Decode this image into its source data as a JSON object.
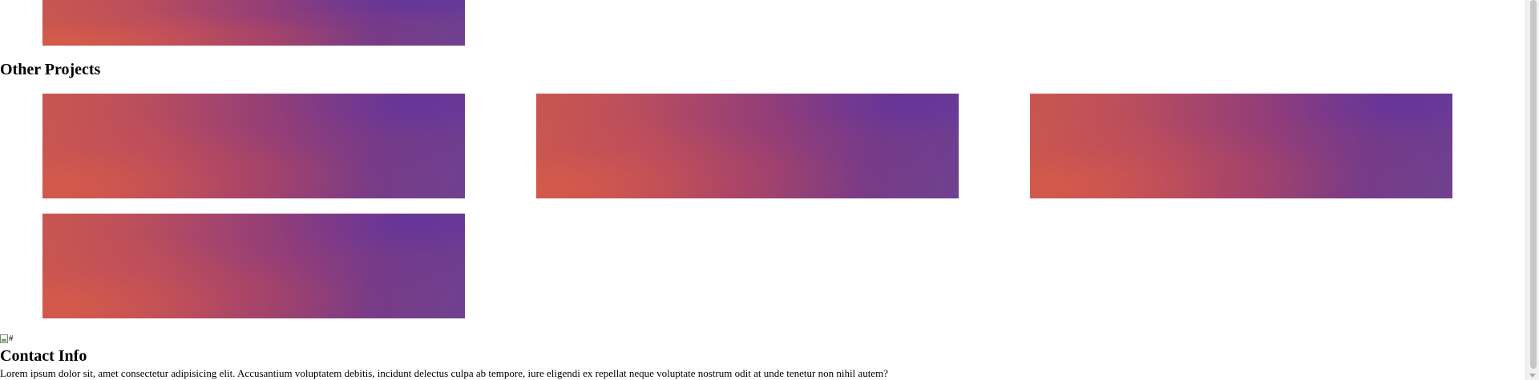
{
  "projects": {
    "other_heading": "Other Projects"
  },
  "broken_image": {
    "alt": "#"
  },
  "contact": {
    "heading": "Contact Info",
    "body": "Lorem ipsum dolor sit, amet consectetur adipisicing elit. Accusantium voluptatem debitis, incidunt delectus culpa ab tempore, iure eligendi ex repellat neque voluptate nostrum odit at unde tenetur non nihil autem?"
  },
  "icons": {
    "broken_image": "broken-image-icon",
    "scroll_down": "chevron-down-icon"
  },
  "colors": {
    "tile_orange": "#c9574f",
    "tile_magenta": "#9c3f71",
    "tile_purple": "#6f4190",
    "scrollbar_track": "#f1f1f1",
    "scrollbar_thumb": "#c7c7c7"
  }
}
